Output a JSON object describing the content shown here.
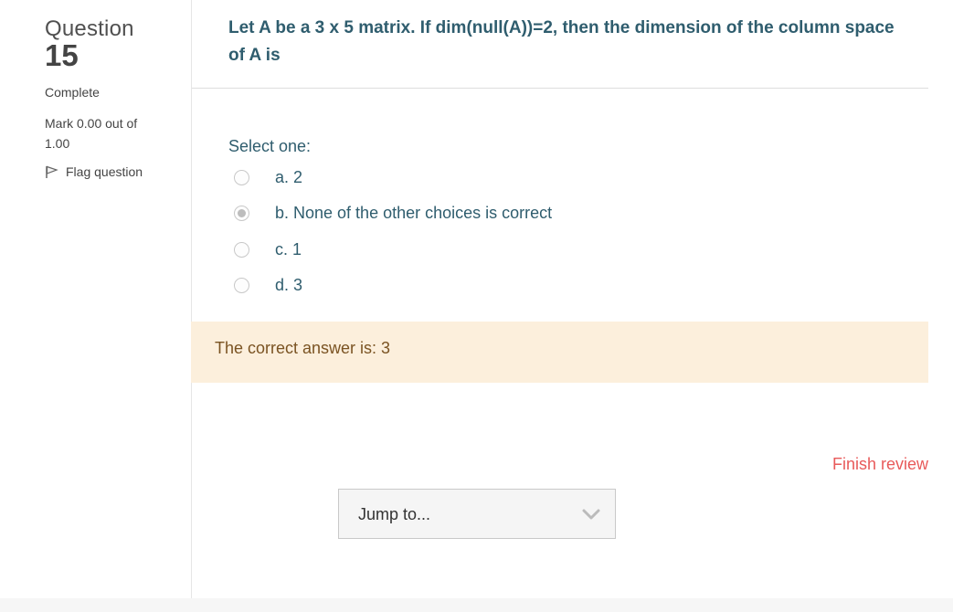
{
  "info": {
    "question_word": "Question",
    "question_number": "15",
    "state": "Complete",
    "grade": "Mark 0.00 out of 1.00",
    "flag_label": "Flag question"
  },
  "question": {
    "text": "Let A be a 3 x 5 matrix. If dim(null(A))=2, then the dimension of the column space of A is",
    "prompt": "Select one:",
    "answers": [
      {
        "label": "a. 2",
        "selected": false
      },
      {
        "label": "b. None of the other choices is correct",
        "selected": true
      },
      {
        "label": "c. 1",
        "selected": false
      },
      {
        "label": "d. 3",
        "selected": false
      }
    ],
    "feedback": "The correct answer is: 3"
  },
  "nav": {
    "finish_label": "Finish review",
    "jump_label": "Jump to..."
  },
  "icons": {
    "flag": "flag-icon",
    "chevron": "chevron-down-icon"
  },
  "colors": {
    "question_text": "#2f5d6e",
    "feedback_bg": "#fcefdc",
    "finish_link": "#e85a5a"
  }
}
